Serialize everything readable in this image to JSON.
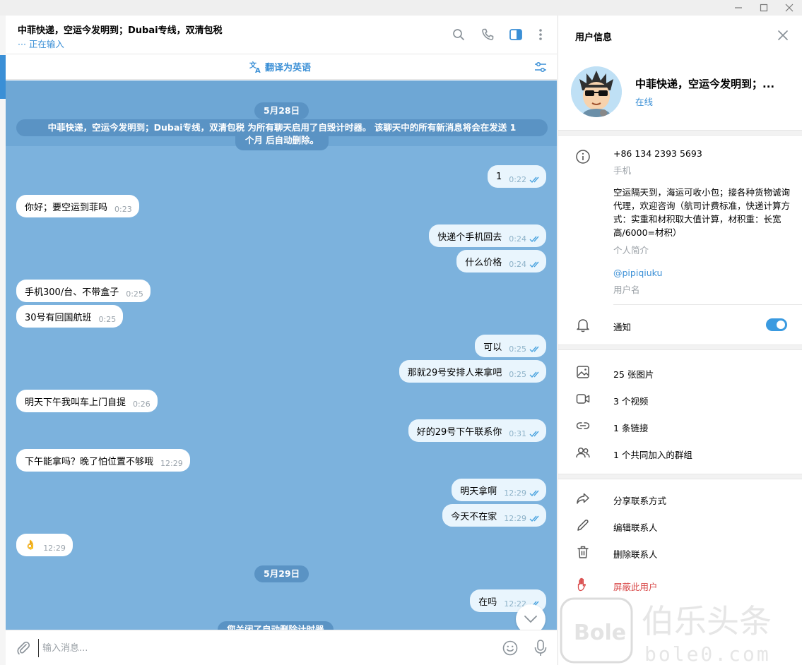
{
  "chat": {
    "title": "中菲快递，空运今发明到；Dubai专线，双清包税",
    "status": "··· 正在输入",
    "translate_label": "翻译为英语",
    "input_placeholder": "输入消息...",
    "date_1": "5月28日",
    "date_2": "5月29日",
    "system_timer_line1": "中菲快递，空运今发明到；Dubai专线，双清包税 为所有聊天启用了自毁计时器。 该聊天中的所有新消息将会在发送 1",
    "system_timer_line2": "个月 后自动删除。",
    "system_timer_off": "您关闭了自动删除计时器",
    "messages": [
      {
        "dir": "out",
        "text": "1",
        "time": "0:22"
      },
      {
        "dir": "in",
        "text": "你好；要空运到菲吗",
        "time": "0:23"
      },
      {
        "dir": "out",
        "text": "快递个手机回去",
        "time": "0:24"
      },
      {
        "dir": "out",
        "text": "什么价格",
        "time": "0:24"
      },
      {
        "dir": "in",
        "text": "手机300/台、不带盒子",
        "time": "0:25"
      },
      {
        "dir": "in",
        "text": "30号有回国航班",
        "time": "0:25"
      },
      {
        "dir": "out",
        "text": "可以",
        "time": "0:25"
      },
      {
        "dir": "out",
        "text": "那就29号安排人来拿吧",
        "time": "0:25"
      },
      {
        "dir": "in",
        "text": "明天下午我叫车上门自提",
        "time": "0:26"
      },
      {
        "dir": "out",
        "text": "好的29号下午联系你",
        "time": "0:31"
      },
      {
        "dir": "in",
        "text": "下午能拿吗？晚了怕位置不够哦",
        "time": "12:29"
      },
      {
        "dir": "out",
        "text": "明天拿啊",
        "time": "12:29"
      },
      {
        "dir": "out",
        "text": "今天不在家",
        "time": "12:29"
      },
      {
        "dir": "in",
        "text": "👌",
        "time": "12:29"
      },
      {
        "dir": "out",
        "text": "在吗",
        "time": "12:22"
      }
    ]
  },
  "panel": {
    "title": "用户信息",
    "name": "中菲快递，空运今发明到；...",
    "online": "在线",
    "phone": "+86 134 2393 5693",
    "phone_label": "手机",
    "bio": "空运隔天到，海运可收小包；接各种货物诚询代理，欢迎咨询（航司计费标准，快递计算方式：实重和材积取大值计算，材积重：长宽高/6000=材积）",
    "bio_label": "个人简介",
    "username": "@pipiqiuku",
    "username_label": "用户名",
    "notifications": "通知",
    "notifications_on": true,
    "media": [
      {
        "icon": "photo-icon",
        "label": "25 张图片"
      },
      {
        "icon": "video-icon",
        "label": "3 个视频"
      },
      {
        "icon": "link-icon",
        "label": "1 条链接"
      },
      {
        "icon": "group-icon",
        "label": "1 个共同加入的群组"
      }
    ],
    "actions": [
      {
        "icon": "share-icon",
        "label": "分享联系方式"
      },
      {
        "icon": "edit-icon",
        "label": "编辑联系人"
      },
      {
        "icon": "trash-icon",
        "label": "删除联系人"
      },
      {
        "icon": "block-icon",
        "label": "屏蔽此用户"
      }
    ]
  },
  "colors": {
    "accent": "#3a8fd6",
    "chat_bg": "#7cb2dd",
    "outgoing_bubble": "#e9f5fd",
    "danger": "#d94b4b"
  },
  "watermark": "伯乐头条 bole0.com"
}
